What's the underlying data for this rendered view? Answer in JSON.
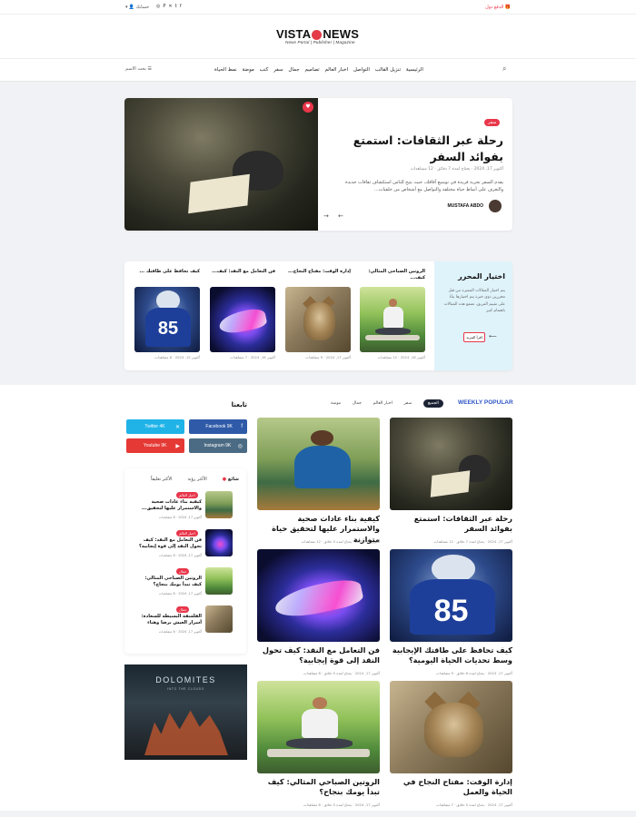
{
  "topbar": {
    "promo": "الدفع دول",
    "account": "حسابك",
    "social_icons": [
      "facebook-icon",
      "x-icon",
      "twitter-icon",
      "pinterest-icon",
      "instagram-icon"
    ]
  },
  "logo": {
    "brand": "VISTA",
    "brand2": "NEWS",
    "tagline": "News Portal  |  Publisher  |  Magazine"
  },
  "nav": {
    "items": [
      "الرئيسية",
      "تنزيل القالب",
      "التواصل",
      "اخبار العالم",
      "تصاميم",
      "جمال",
      "سفر",
      "كتب",
      "موضة",
      "نمط الحياة"
    ],
    "search_label": "بحث الاسم"
  },
  "hero": {
    "badge": "سفر",
    "title": "رحلة عبر الثقافات: استمتع بفوائد السفر",
    "meta": "أكتوبر 17, 2024  ·  يحتاج لمدة 7 دقائق  ·  12 مشاهدات",
    "excerpt": "يقدم السفر تجربة فريدة في توسيع آفاقك، حيث يتيح للناس استكشاف ثقافات جديدة والتعرف على أنماط حياة مختلفة والتواصل مع أشخاص من خلفيات...",
    "author": "MUSTAFA ABDO"
  },
  "editors": {
    "title": "اختيار المحرر",
    "text": "يتم اختيار المقالات المميزة من قبل محررين ذوي خبرة يتم اختيارها بناءً على تقييم الفريق، تعتمع هذه المقالات باهتمام كبير",
    "button": "اقرأ المزيد",
    "items": [
      {
        "title": "الروتين الصباحي المثالي: كيف...",
        "meta": "أكتوبر 18, 2024  ·  12 مشاهدات"
      },
      {
        "title": "إدارة الوقت: مفتاح النجاح...",
        "meta": "أكتوبر 17, 2024  ·  9 مشاهدات"
      },
      {
        "title": "فن التعامل مع النقد: كيف...",
        "meta": "أكتوبر 16, 2024  ·  7 مشاهدات"
      },
      {
        "title": "كيف تحافظ على طاقتك ...",
        "meta": "أكتوبر 15, 2024  ·  6 مشاهدات"
      }
    ]
  },
  "popular": {
    "heading": "WEEKLY POPULAR",
    "tabs": [
      "الجميع",
      "سفر",
      "اخبار العالم",
      "جمال",
      "موضة"
    ],
    "articles": [
      {
        "title": "رحلة عبر الثقافات: استمتع بفوائد السفر",
        "meta": "أكتوبر 17, 2024  ·  يحتاج لمدة 7 دقائق  ·  12 مشاهدات"
      },
      {
        "title": "كيفية بناء عادات صحية والاستمرار عليها لتحقيق حياة متوازنة",
        "meta": "أكتوبر 17, 2024  ·  يحتاج لمدة 5 دقائق  ·  12 مشاهدات"
      },
      {
        "title": "كيف تحافظ على طاقتك الإيجابية وسط تحديات الحياة اليومية؟",
        "meta": "أكتوبر 17, 2024  ·  يحتاج لمدة 6 دقائق  ·  9 مشاهدات"
      },
      {
        "title": "فن التعامل مع النقد: كيف تحول النقد إلى قوة إيجابية؟",
        "meta": "أكتوبر 17, 2024  ·  يحتاج لمدة 5 دقائق  ·  8 مشاهدات"
      },
      {
        "title": "إدارة الوقت: مفتاح النجاح في الحياة والعمل",
        "meta": "أكتوبر 17, 2024  ·  يحتاج لمدة 5 دقائق  ·  7 مشاهدات"
      },
      {
        "title": "الروتين الصباحي المثالي: كيف تبدأ يومك بنجاح؟",
        "meta": "أكتوبر 17, 2024  ·  يحتاج لمدة 5 دقائق  ·  6 مشاهدات"
      }
    ]
  },
  "follow": {
    "title": "تابعنا",
    "buttons": [
      {
        "label": "Facebook 9K",
        "color": "#2f5aa8"
      },
      {
        "label": "Twitter 4K",
        "color": "#1fb3e8"
      },
      {
        "label": "Instagram 9K",
        "color": "#4b6b84"
      },
      {
        "label": "Youtube 9K",
        "color": "#e53935"
      }
    ]
  },
  "side_tabs": [
    "شائع",
    "الأكثر رؤية",
    "الأكثر تعليقاً"
  ],
  "side_list": [
    {
      "badge": "اخبار العالم",
      "title": "كيفية بناء عادات صحية والاستمرار عليها لتحقيق...",
      "meta": "أكتوبر 17, 2024  ·  6 مشاهدات"
    },
    {
      "badge": "اخبار العالم",
      "title": "فن التعامل مع النقد: كيف تحول النقد إلى قوة إيجابية؟",
      "meta": "أكتوبر 17, 2024  ·  8 مشاهدات"
    },
    {
      "badge": "جمال",
      "title": "الروتين الصباحي المثالي: كيف تبدأ يومك بنجاح؟",
      "meta": "أكتوبر 17, 2024  ·  6 مشاهدات"
    },
    {
      "badge": "جمال",
      "title": "الفلسفة البسيطة للسعادة: أسرار العيش برضا وهناء",
      "meta": "أكتوبر 17, 2024  ·  6 مشاهدات"
    }
  ],
  "ad": {
    "title": "DOLOMITES",
    "subtitle": "INTO THE CLOUDS"
  }
}
